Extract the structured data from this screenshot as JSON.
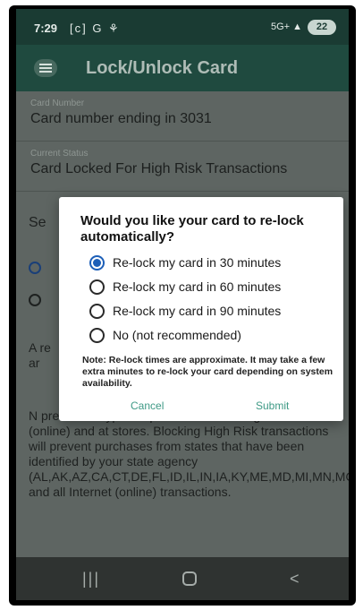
{
  "status_bar": {
    "time": "7:29",
    "left_icons": "[c] G ⚘",
    "signal": "5G+ ▲",
    "battery": "22"
  },
  "app_bar": {
    "title": "Lock/Unlock Card"
  },
  "card_number_field": {
    "label": "Card Number",
    "value": "Card number ending in 3031"
  },
  "status_field": {
    "label": "Current Status",
    "value": "Card Locked For High Risk Transactions"
  },
  "background": {
    "section_prefix": "Se",
    "para1_prefix": "A re ar",
    "para2": "N prevent all types of purchases including Internet (online) and at stores. Blocking High Risk transactions will prevent purchases from states that have been identified by your state agency (AL,AK,AZ,CA,CT,DE,FL,ID,IL,IN,IA,KY,ME,MD,MI,MN,MO,MT,NV,NH,NJ,NM,NC,ND,OH,OK,PA,RI,SD,UT,VT,VA,WI,WY) and all Internet (online) transactions."
  },
  "dialog": {
    "title": "Would you like your card to re-lock automatically?",
    "options": [
      {
        "label": "Re-lock my card in 30 minutes",
        "selected": true
      },
      {
        "label": "Re-lock my card in 60 minutes",
        "selected": false
      },
      {
        "label": "Re-lock my card in 90 minutes",
        "selected": false
      },
      {
        "label": "No (not recommended)",
        "selected": false
      }
    ],
    "note": "Note: Re-lock times are approximate. It may take a few extra minutes to re-lock your card depending on system availability.",
    "cancel_label": "Cancel",
    "submit_label": "Submit"
  },
  "navbar": {
    "recent_icon": "recent-apps-icon",
    "home_icon": "home-icon",
    "back_icon": "back-icon"
  },
  "colors": {
    "app_bar": "#1f4a3f",
    "accent": "#1d5fb8",
    "button_text": "#3f9a86"
  }
}
